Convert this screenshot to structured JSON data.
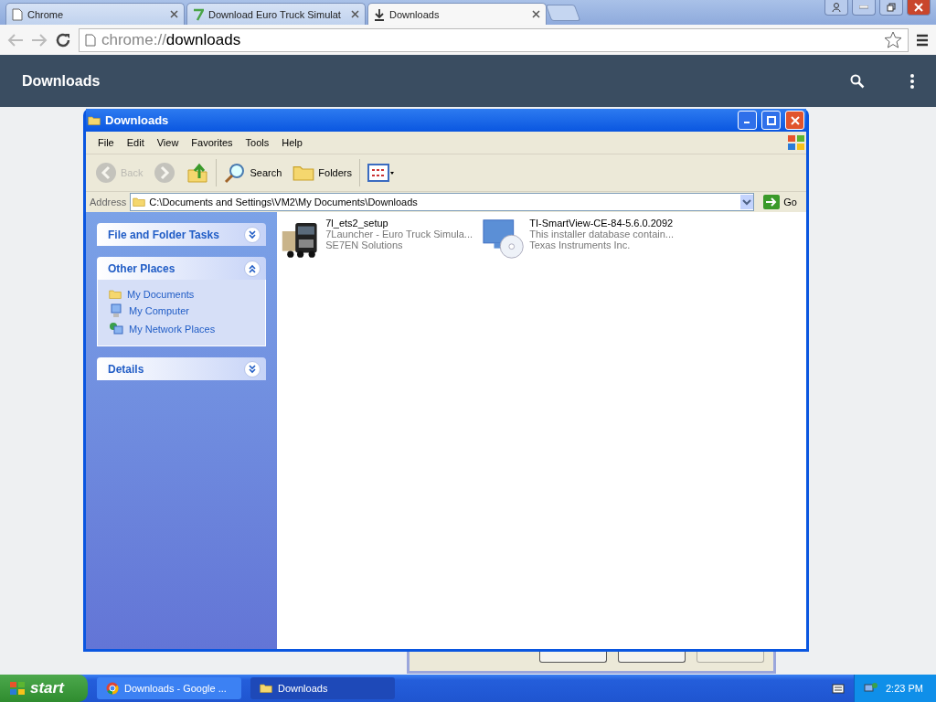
{
  "browser": {
    "tabs": [
      {
        "title": "Chrome",
        "kind": "page",
        "selected": false
      },
      {
        "title": "Download Euro Truck Simulat",
        "kind": "seven",
        "selected": false
      },
      {
        "title": "Downloads",
        "kind": "download",
        "selected": true
      }
    ],
    "address": {
      "scheme": "chrome://",
      "path": "downloads"
    }
  },
  "page_header": {
    "title": "Downloads"
  },
  "explorer": {
    "title": "Downloads",
    "menu": [
      "File",
      "Edit",
      "View",
      "Favorites",
      "Tools",
      "Help"
    ],
    "toolbar": [
      {
        "kind": "back",
        "label": "Back",
        "disabled": true
      },
      {
        "kind": "forward",
        "disabled": true
      },
      {
        "kind": "up",
        "disabled": false
      },
      {
        "kind": "search",
        "label": "Search",
        "disabled": false
      },
      {
        "kind": "folders",
        "label": "Folders",
        "disabled": false
      },
      {
        "kind": "views",
        "disabled": false
      }
    ],
    "address_label": "Address",
    "address": "C:\\Documents and Settings\\VM2\\My Documents\\Downloads",
    "go": "Go",
    "panels": [
      {
        "title": "File and Folder Tasks",
        "expanded": false
      },
      {
        "title": "Other Places",
        "expanded": true,
        "items": [
          {
            "label": "My Documents",
            "kind": "folder"
          },
          {
            "label": "My Computer",
            "kind": "computer"
          },
          {
            "label": "My Network Places",
            "kind": "network"
          }
        ]
      },
      {
        "title": "Details",
        "expanded": false
      }
    ],
    "files": [
      {
        "name": "7l_ets2_setup",
        "description": "7Launcher - Euro Truck Simula...",
        "publisher": "SE7EN Solutions",
        "kind": "truck"
      },
      {
        "name": "TI-SmartView-CE-84-5.6.0.2092",
        "description": "This installer database contain...",
        "publisher": "Texas Instruments Inc.",
        "kind": "installer"
      }
    ]
  },
  "taskbar": {
    "start": "start",
    "tasks": [
      {
        "label": "Downloads - Google ...",
        "kind": "chrome",
        "selected": false
      },
      {
        "label": "Downloads",
        "kind": "folder",
        "selected": true
      }
    ],
    "clock": "2:23 PM"
  }
}
